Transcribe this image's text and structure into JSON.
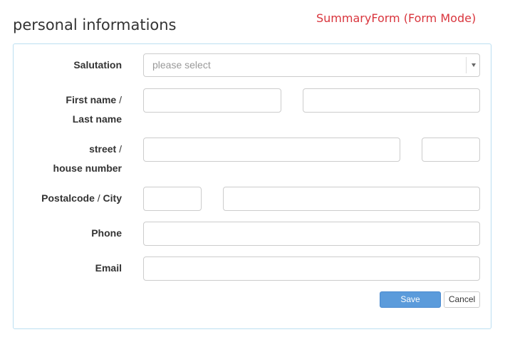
{
  "header": {
    "title": "personal informations",
    "mode_tag": "SummaryForm (Form Mode)"
  },
  "form": {
    "salutation": {
      "label": "Salutation",
      "placeholder": "please select"
    },
    "name": {
      "label_first": "First name",
      "separator": "/",
      "label_last": "Last name",
      "first_value": "",
      "last_value": ""
    },
    "street": {
      "label_street": "street",
      "separator": "/",
      "label_house": "house number",
      "street_value": "",
      "house_value": ""
    },
    "postal": {
      "label_postal": "Postalcode",
      "separator": "/",
      "label_city": "City",
      "postal_value": "",
      "city_value": ""
    },
    "phone": {
      "label": "Phone",
      "value": ""
    },
    "email": {
      "label": "Email",
      "value": ""
    }
  },
  "actions": {
    "save_label": "Save",
    "cancel_label": "Cancel"
  },
  "colors": {
    "mode_tag": "#d9353d",
    "panel_border": "#bcdff1",
    "save_button": "#5b9bdb"
  }
}
